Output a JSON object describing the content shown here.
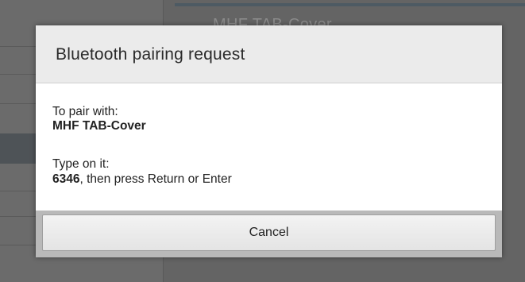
{
  "background": {
    "title": "MHF TAB-Cover"
  },
  "dialog": {
    "title": "Bluetooth pairing request",
    "pair_label": "To pair with:",
    "device_name": "MHF TAB-Cover",
    "type_label": "Type on it:",
    "pin": "6346",
    "instruction": ", then press Return or Enter",
    "cancel_label": "Cancel"
  },
  "colors": {
    "dim_overlay": "#5f5f5f",
    "dialog_header": "#ebebeb",
    "dialog_body": "#ffffff",
    "footer": "#b9b9b9"
  }
}
